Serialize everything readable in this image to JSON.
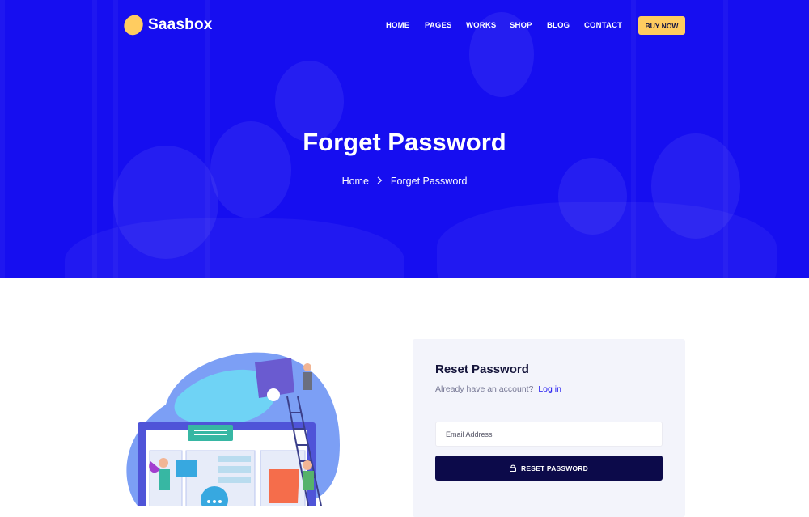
{
  "brand": {
    "name": "Saasbox"
  },
  "nav": {
    "items": [
      "HOME",
      "PAGES",
      "WORKS",
      "SHOP",
      "BLOG",
      "CONTACT"
    ],
    "cta": "BUY NOW"
  },
  "hero": {
    "title": "Forget Password",
    "breadcrumb": [
      "Home",
      "Forget Password"
    ]
  },
  "form": {
    "title": "Reset Password",
    "subtitle": "Already have an account?",
    "login_link": "Log in",
    "email_placeholder": "Email Address",
    "submit_label": "RESET PASSWORD"
  },
  "icons": [
    "brand-logo-icon",
    "chevron-right-icon",
    "lock-icon"
  ],
  "colors": {
    "primary": "#1a12f0",
    "accent": "#ffcc60",
    "button": "#0c0a4a",
    "card": "#f3f4fb"
  }
}
